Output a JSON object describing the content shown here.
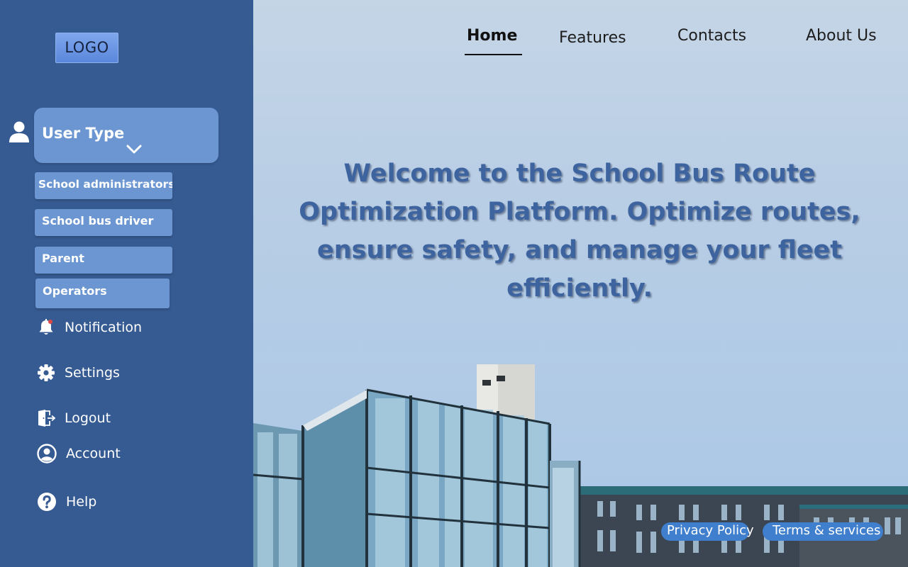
{
  "sidebar": {
    "logo_text": "LOGO",
    "user_type": {
      "label": "User Type",
      "options": [
        "School administrators",
        "School bus driver",
        "Parent",
        "Operators"
      ]
    },
    "items": [
      {
        "label": "Notification",
        "icon": "bell-icon"
      },
      {
        "label": "Settings",
        "icon": "gear-icon"
      },
      {
        "label": "Logout",
        "icon": "logout-door-icon"
      },
      {
        "label": "Account",
        "icon": "account-circle-icon"
      },
      {
        "label": "Help",
        "icon": "help-circle-icon"
      }
    ]
  },
  "topnav": {
    "items": [
      "Home",
      "Features",
      "Contacts",
      "About Us"
    ],
    "active": "Home"
  },
  "hero": {
    "headline": "Welcome to the School Bus Route Optimization Platform. Optimize routes, ensure safety, and manage your fleet efficiently."
  },
  "footer": {
    "privacy": "Privacy Policy",
    "terms": "Terms & services"
  },
  "colors": {
    "sidebar": "#365b93",
    "accent": "#6b96d1",
    "headline": "#3e64a0",
    "footer_pill": "#3f7fcd"
  }
}
